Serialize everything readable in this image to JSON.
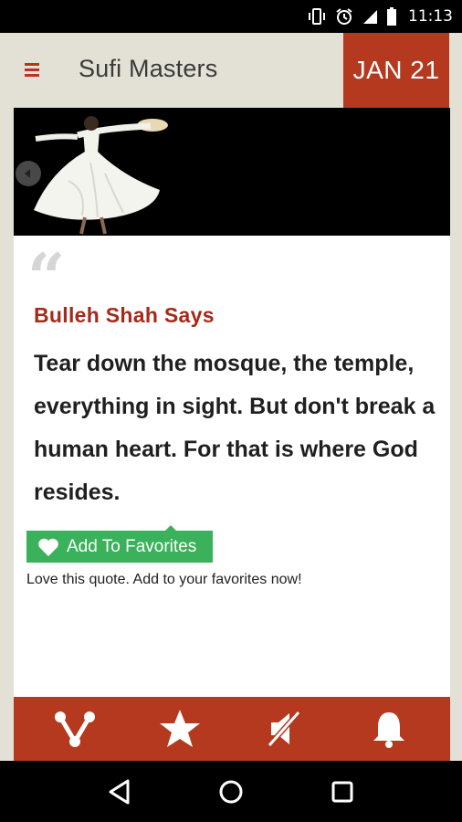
{
  "status_bar": {
    "time": "11:13",
    "icons": [
      "vibrate-icon",
      "alarm-icon",
      "signal-icon",
      "battery-icon"
    ]
  },
  "header": {
    "menu_icon": "hamburger-menu-icon",
    "title": "Sufi Masters",
    "date": "JAN 21"
  },
  "hero": {
    "image": "whirling-dervish-illustration",
    "prev_icon": "chevron-left-icon"
  },
  "quote": {
    "author_line": "Bulleh Shah Says",
    "text": "Tear down the mosque, the temple, everything in sight. But don't break a human heart. For that is where God resides."
  },
  "favorites": {
    "button_label": "Add To Favorites",
    "hint": "Love this quote. Add to your favorites now!"
  },
  "bottom_bar": {
    "items": [
      "share-icon",
      "star-icon",
      "mute-icon",
      "bell-icon"
    ]
  },
  "nav_bar": {
    "items": [
      "back-icon",
      "home-icon",
      "recents-icon"
    ]
  },
  "colors": {
    "accent": "#b5391f",
    "author": "#a62a1b",
    "favorite": "#3bb15b",
    "background": "#e3e1d5"
  }
}
